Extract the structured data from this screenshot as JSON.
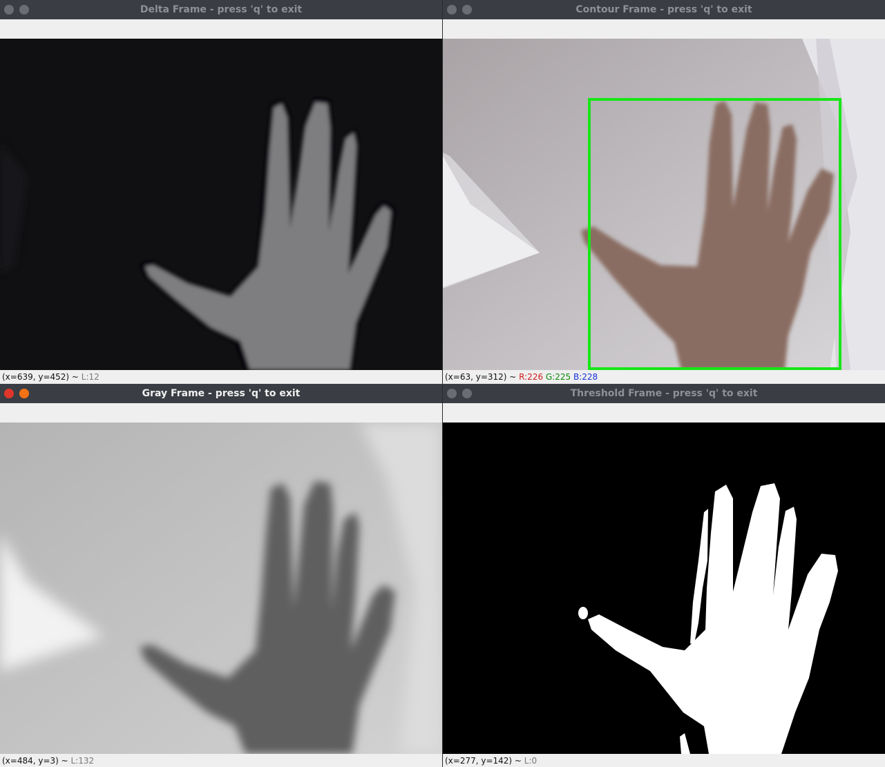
{
  "windows": {
    "delta": {
      "title": "Delta Frame - press 'q' to exit",
      "status": {
        "coords": "(x=639, y=452) ~ ",
        "level": "L:12"
      }
    },
    "contour": {
      "title": "Contour Frame - press 'q' to exit",
      "status": {
        "coords": "(x=63, y=312) ~ ",
        "r": "R:226",
        "g": "G:225",
        "b": "B:228"
      },
      "box_color": "#16e616"
    },
    "gray": {
      "title": "Gray Frame - press 'q' to exit",
      "active": true,
      "status": {
        "coords": "(x=484, y=3) ~ ",
        "level": "L:132"
      }
    },
    "threshold": {
      "title": "Threshold Frame - press 'q' to exit",
      "status": {
        "coords": "(x=277, y=142) ~ ",
        "level": "L:0"
      }
    }
  },
  "icons": {
    "close": "close-icon",
    "minimize": "minimize-icon"
  }
}
